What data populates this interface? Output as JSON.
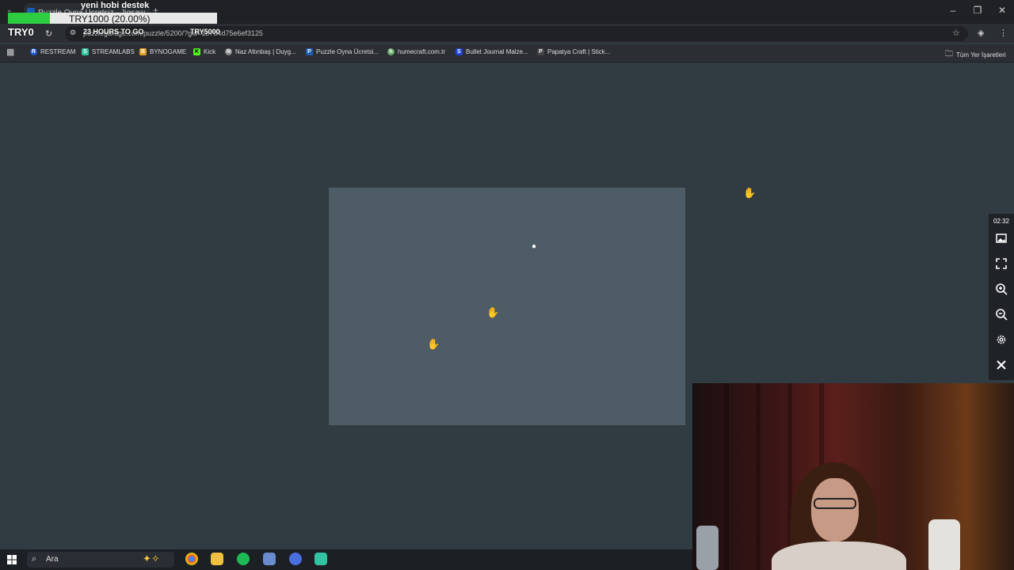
{
  "browser": {
    "tab_title": "Puzzle Oyna Ücretsiz - Jigsaw...",
    "url": "puzzlegarage.com/puzzle/5200/?gid=1b784d75e6ef3125",
    "new_tab_glyph": "+",
    "bookmarks": [
      {
        "label": "RESTREAM",
        "color": "#1e5bd8",
        "letter": "R"
      },
      {
        "label": "STREAMLABS",
        "color": "#31c3a2",
        "letter": "S"
      },
      {
        "label": "BYNOGAME",
        "color": "#e0a020",
        "letter": "B"
      },
      {
        "label": "Kick",
        "color": "#53fc18",
        "letter": "K"
      },
      {
        "label": "Naz Altınbaş | Duyg...",
        "color": "#888888",
        "letter": "N"
      },
      {
        "label": "Puzzle Oyna Ücretsi...",
        "color": "#1a5fb4",
        "letter": "P"
      },
      {
        "label": "humecraft.com.tr",
        "color": "#6aa86a",
        "letter": "h"
      },
      {
        "label": "Bullet Journal Malze...",
        "color": "#2244cc",
        "letter": "S"
      },
      {
        "label": "Papatya Craft | Stick...",
        "color": "#444444",
        "letter": "P"
      }
    ],
    "all_bookmarks": "Tüm Yer İşaretleri"
  },
  "overlay": {
    "title": "yeni hobi destek",
    "goal_text": "TRY1000 (20.00%)",
    "goal_progress": 0.2,
    "left_label": "TRY0",
    "countdown": "23 HOURS TO GO",
    "right_label": "TRY5000"
  },
  "puzzle": {
    "timer": "02:32",
    "sidebar_icons": [
      "image-icon",
      "fullscreen-icon",
      "zoom-in-icon",
      "zoom-out-icon",
      "settings-icon",
      "close-icon"
    ]
  },
  "taskbar": {
    "search_label": "Ara"
  }
}
